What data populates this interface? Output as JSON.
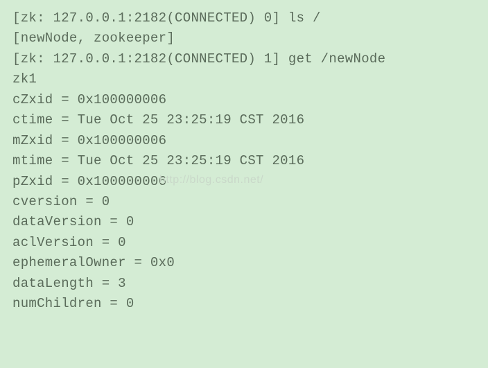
{
  "prompt1": {
    "prefix": "[zk: 127.0.0.1:2182(CONNECTED) 0] ",
    "command": "ls /"
  },
  "ls_output": "[newNode, zookeeper]",
  "prompt2": {
    "prefix": "[zk: 127.0.0.1:2182(CONNECTED) 1] ",
    "command": "get /newNode"
  },
  "data_value": "zk1",
  "stats": {
    "cZxid": "cZxid = 0x100000006",
    "ctime": "ctime = Tue Oct 25 23:25:19 CST 2016",
    "mZxid": "mZxid = 0x100000006",
    "mtime": "mtime = Tue Oct 25 23:25:19 CST 2016",
    "pZxid": "pZxid = 0x100000006",
    "cversion": "cversion = 0",
    "dataVersion": "dataVersion = 0",
    "aclVersion": "aclVersion = 0",
    "ephemeralOwner": "ephemeralOwner = 0x0",
    "dataLength": "dataLength = 3",
    "numChildren": "numChildren = 0"
  },
  "watermark": "http://blog.csdn.net/"
}
